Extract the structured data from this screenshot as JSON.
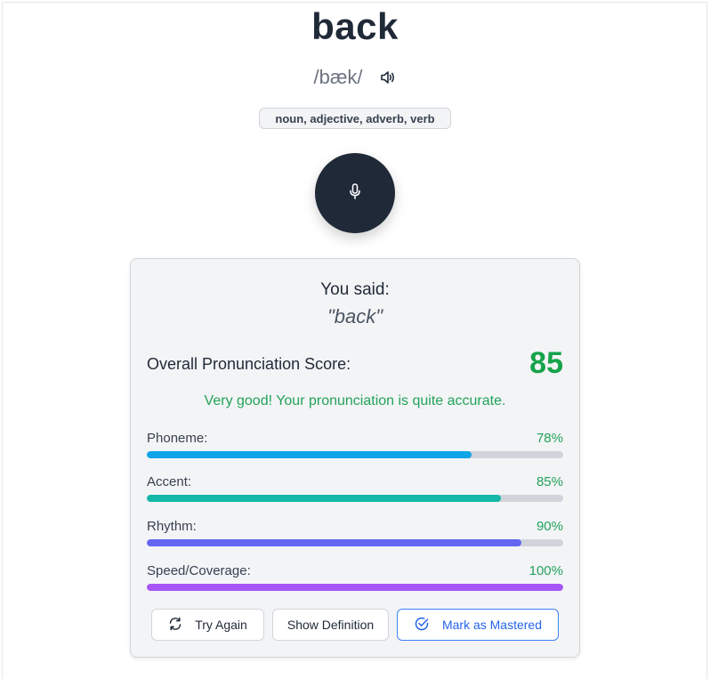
{
  "word": "back",
  "ipa": "/bæk/",
  "parts_of_speech": "noun, adjective, adverb, verb",
  "result": {
    "said_label": "You said:",
    "said_text": "\"back\"",
    "overall_label": "Overall Pronunciation Score:",
    "overall_score": "85",
    "feedback": "Very good! Your pronunciation is quite accurate."
  },
  "metrics": [
    {
      "label": "Phoneme:",
      "value": "78%",
      "fraction": 0.78,
      "color": "#0ea5e9"
    },
    {
      "label": "Accent:",
      "value": "85%",
      "fraction": 0.85,
      "color": "#14b8a6"
    },
    {
      "label": "Rhythm:",
      "value": "90%",
      "fraction": 0.9,
      "color": "#6366f1"
    },
    {
      "label": "Speed/Coverage:",
      "value": "100%",
      "fraction": 1.0,
      "color": "#a855f7"
    }
  ],
  "actions": {
    "try_again": "Try Again",
    "show_definition": "Show Definition",
    "mark_mastered": "Mark as Mastered"
  },
  "icons": {
    "speaker": "speaker-icon",
    "mic": "microphone-icon",
    "refresh": "refresh-icon",
    "check": "check-circle-icon"
  },
  "colors": {
    "score_green": "#16a34a",
    "mic_bg": "#1f2937",
    "mastered_blue": "#2563eb"
  }
}
